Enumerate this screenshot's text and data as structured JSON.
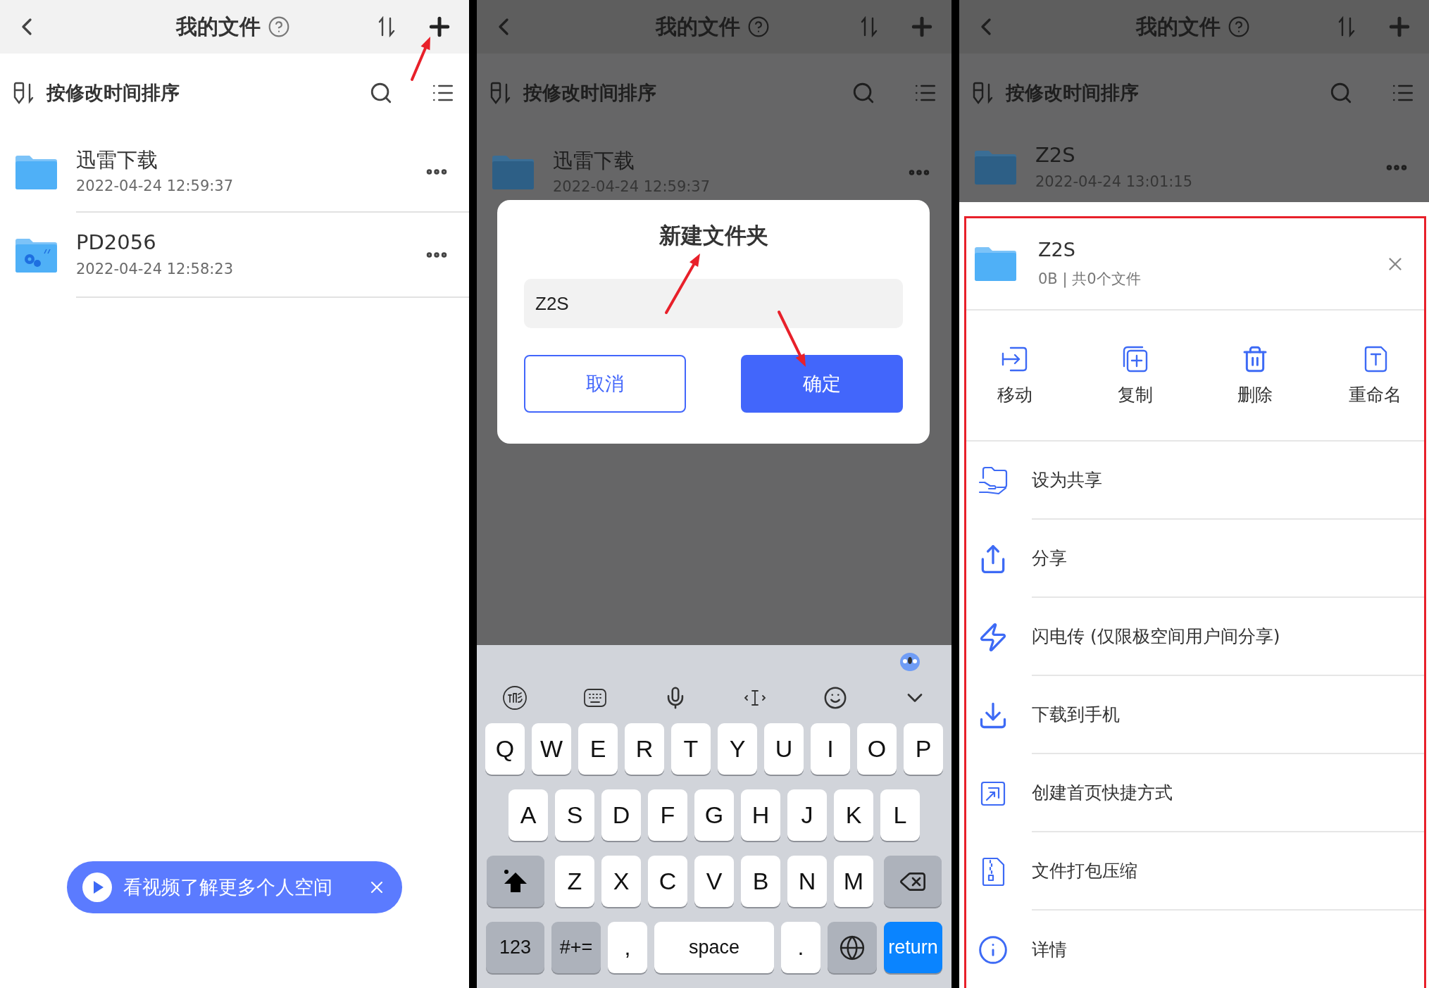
{
  "screens": [
    {
      "dimmed": false,
      "header": {
        "title": "我的文件"
      },
      "sort_bar": {
        "label": "按修改时间排序"
      },
      "files": [
        {
          "name": "迅雷下载",
          "date": "2022-04-24 12:59:37",
          "kind": "folder"
        },
        {
          "name": "PD2056",
          "date": "2022-04-24 12:58:23",
          "kind": "settings-folder"
        }
      ],
      "toast": {
        "text": "看视频了解更多个人空间"
      }
    },
    {
      "dimmed": true,
      "header": {
        "title": "我的文件"
      },
      "sort_bar": {
        "label": "按修改时间排序"
      },
      "files": [
        {
          "name": "迅雷下载",
          "date": "2022-04-24 12:59:37",
          "kind": "folder"
        }
      ],
      "dialog": {
        "title": "新建文件夹",
        "value": "Z2S",
        "buttons": [
          {
            "label": "取消",
            "kind": "secondary"
          },
          {
            "label": "确定",
            "kind": "primary"
          }
        ]
      },
      "keyboard": {
        "rows": [
          [
            "Q",
            "W",
            "E",
            "R",
            "T",
            "Y",
            "U",
            "I",
            "O",
            "P"
          ],
          [
            "A",
            "S",
            "D",
            "F",
            "G",
            "H",
            "J",
            "K",
            "L"
          ],
          [
            {
              "kind": "shift"
            },
            "Z",
            "X",
            "C",
            "V",
            "B",
            "N",
            "M",
            {
              "kind": "delete"
            }
          ]
        ],
        "bottom_row": [
          {
            "label": "123",
            "kind": "function"
          },
          {
            "label": "#+=",
            "kind": "function"
          },
          {
            "label": ",",
            "kind": "letter"
          },
          {
            "label": "space",
            "kind": "space"
          },
          {
            "label": ".",
            "kind": "letter"
          },
          {
            "kind": "globe"
          },
          {
            "label": "return",
            "kind": "return"
          }
        ]
      }
    },
    {
      "dimmed": true,
      "header": {
        "title": "我的文件"
      },
      "sort_bar": {
        "label": "按修改时间排序"
      },
      "files": [
        {
          "name": "Z2S",
          "date": "2022-04-24 13:01:15",
          "kind": "folder"
        }
      ],
      "sheet": {
        "name": "Z2S",
        "info": "0B | 共0个文件",
        "actions": [
          {
            "label": "移动",
            "kind": "move"
          },
          {
            "label": "复制",
            "kind": "copy"
          },
          {
            "label": "删除",
            "kind": "delete"
          },
          {
            "label": "重命名",
            "kind": "rename"
          }
        ],
        "menu": [
          {
            "label": "设为共享",
            "kind": "share-set"
          },
          {
            "label": "分享",
            "kind": "share"
          },
          {
            "label": "闪电传 (仅限极空间用户间分享)",
            "kind": "flash"
          },
          {
            "label": "下载到手机",
            "kind": "download"
          },
          {
            "label": "创建首页快捷方式",
            "kind": "shortcut"
          },
          {
            "label": "文件打包压缩",
            "kind": "zip"
          },
          {
            "label": "详情",
            "kind": "info"
          }
        ]
      }
    }
  ]
}
